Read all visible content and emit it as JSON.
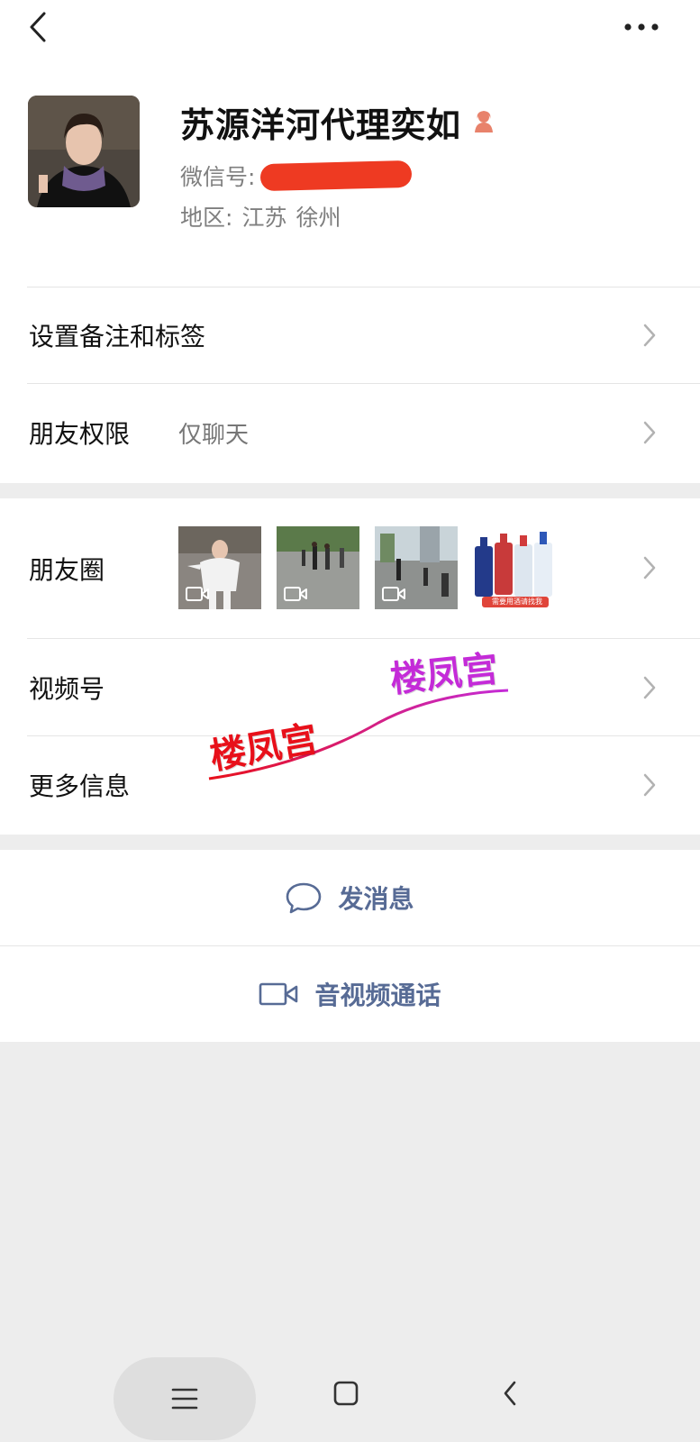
{
  "header": {
    "back_icon": "chevron-left-icon",
    "more_icon": "ellipsis-icon"
  },
  "profile": {
    "name": "苏源洋河代理奕如",
    "wechat_id_label": "微信号:",
    "region_label": "地区:",
    "region_province": "江苏",
    "region_city": "徐州",
    "gender_icon": "female-icon"
  },
  "rows": {
    "remark_label": "设置备注和标签",
    "permission_label": "朋友权限",
    "permission_value": "仅聊天",
    "moments_label": "朋友圈",
    "channels_label": "视频号",
    "more_info_label": "更多信息"
  },
  "moments": {
    "thumb4_caption": "需要用酒请找我"
  },
  "watermarks": {
    "text1": "楼凤宫",
    "text2": "楼凤宫"
  },
  "actions": {
    "message_label": "发消息",
    "call_label": "音视频通话"
  },
  "colors": {
    "link": "#576b95",
    "redact": "#ee3a22",
    "bg": "#ededed"
  }
}
